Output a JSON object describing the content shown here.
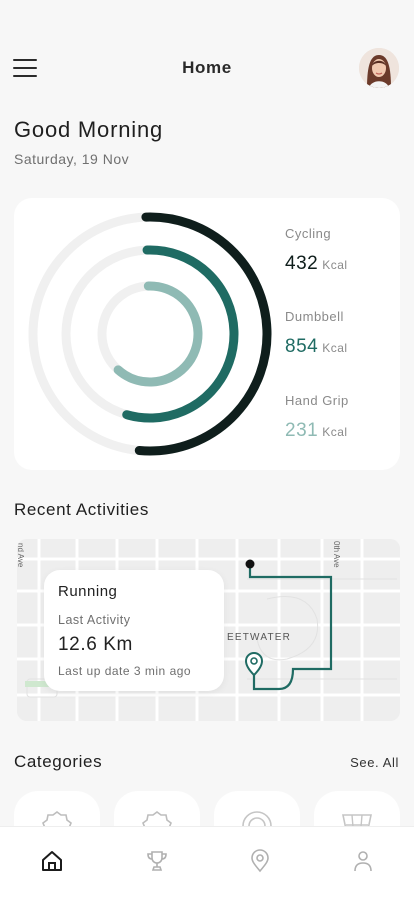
{
  "header": {
    "title": "Home",
    "menu_icon": "hamburger-menu-icon",
    "avatar": "user-avatar"
  },
  "greeting": {
    "title": "Good Morning",
    "date": "Saturday, 19 Nov"
  },
  "stats": [
    {
      "label": "Cycling",
      "value": "432",
      "unit": "Kcal",
      "color": "#0f1e1c",
      "progress": 0.52
    },
    {
      "label": "Dumbbell",
      "value": "854",
      "unit": "Kcal",
      "color": "#1f6b63",
      "progress": 0.55
    },
    {
      "label": "Hand Grip",
      "value": "231",
      "unit": "Kcal",
      "color": "#8fbab4",
      "progress": 0.62
    }
  ],
  "recent": {
    "title": "Recent Activities",
    "map_labels": {
      "left_street": "nd Ave",
      "right_street": "0th Ave",
      "place": "EETWATER"
    },
    "card": {
      "title": "Running",
      "subtitle": "Last Activity",
      "distance": "12.6 Km",
      "updated": "Last up date 3 min ago"
    }
  },
  "categories": {
    "title": "Categories",
    "see_all": "See. All",
    "items": [
      {
        "icon": "badge-icon"
      },
      {
        "icon": "badge-icon"
      },
      {
        "icon": "location-icon"
      },
      {
        "icon": "basket-icon"
      }
    ]
  },
  "tabbar": {
    "items": [
      {
        "icon": "home-icon",
        "active": true
      },
      {
        "icon": "trophy-icon",
        "active": false
      },
      {
        "icon": "location-icon",
        "active": false
      },
      {
        "icon": "profile-icon",
        "active": false
      }
    ]
  },
  "colors": {
    "background": "#f7f7f7",
    "accent_dark": "#0f1e1c",
    "accent": "#1f6b63",
    "accent_light": "#8fbab4"
  }
}
